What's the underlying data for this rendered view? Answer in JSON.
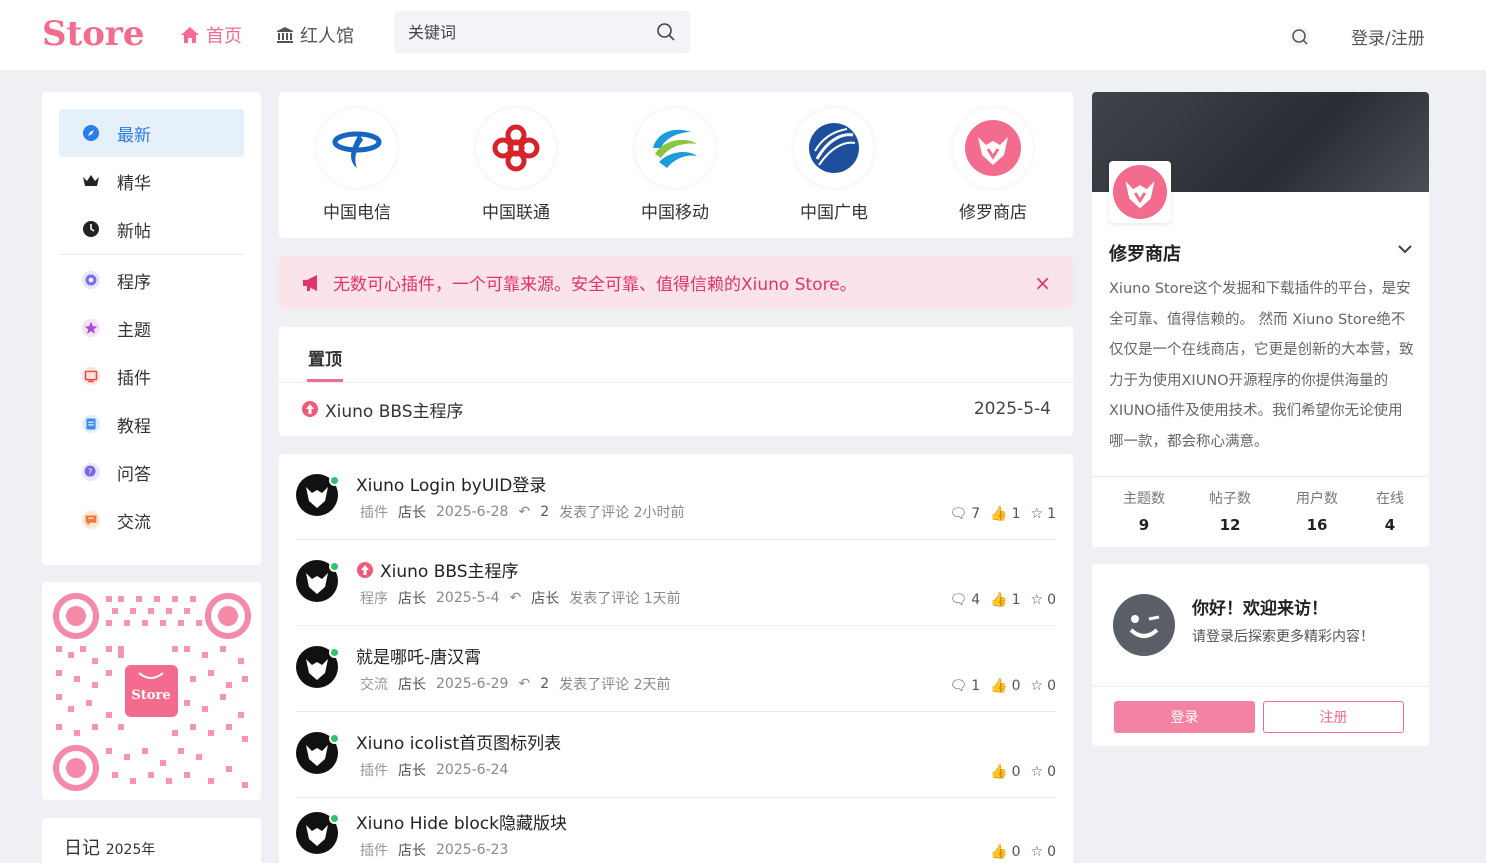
{
  "header": {
    "logo": "Store",
    "nav": [
      {
        "label": "首页",
        "icon": "home-icon"
      },
      {
        "label": "红人馆",
        "icon": "building-icon"
      }
    ],
    "search_placeholder": "关键词",
    "login_label": "登录/注册"
  },
  "left_menu": [
    {
      "label": "最新",
      "icon": "compass-icon",
      "active": true
    },
    {
      "label": "精华",
      "icon": "crown-icon"
    },
    {
      "label": "新帖",
      "icon": "clock-icon"
    },
    {
      "label": "程序",
      "icon": "gear-icon"
    },
    {
      "label": "主题",
      "icon": "star-icon"
    },
    {
      "label": "插件",
      "icon": "plugin-icon"
    },
    {
      "label": "教程",
      "icon": "document-icon"
    },
    {
      "label": "问答",
      "icon": "question-icon"
    },
    {
      "label": "交流",
      "icon": "chat-icon"
    }
  ],
  "qr": {
    "logo_text": "Store"
  },
  "diary": {
    "title": "日记",
    "year": "2025年"
  },
  "brands": [
    {
      "label": "中国电信"
    },
    {
      "label": "中国联通"
    },
    {
      "label": "中国移动"
    },
    {
      "label": "中国广电"
    },
    {
      "label": "修罗商店"
    }
  ],
  "notice": {
    "text": "无数可心插件，一个可靠来源。安全可靠、值得信赖的Xiuno Store。",
    "close": "×"
  },
  "pinned": {
    "tab": "置顶",
    "title": "Xiuno BBS主程序",
    "date": "2025-5-4"
  },
  "threads": [
    {
      "title": "Xiuno Login byUID登录",
      "top": false,
      "forum": "插件",
      "author": "店长",
      "date": "2025-6-28",
      "reply_user": "2",
      "reply_text": "发表了评论 2小时前",
      "comments": "7",
      "likes": "1",
      "favs": "1",
      "show_comments": true
    },
    {
      "title": "Xiuno BBS主程序",
      "top": true,
      "forum": "程序",
      "author": "店长",
      "date": "2025-5-4",
      "reply_user": "店长",
      "reply_text": "发表了评论 1天前",
      "comments": "4",
      "likes": "1",
      "favs": "0",
      "show_comments": true
    },
    {
      "title": "就是哪吒-唐汉霄",
      "top": false,
      "forum": "交流",
      "author": "店长",
      "date": "2025-6-29",
      "reply_user": "2",
      "reply_text": "发表了评论 2天前",
      "comments": "1",
      "likes": "0",
      "favs": "0",
      "show_comments": true
    },
    {
      "title": "Xiuno icolist首页图标列表",
      "top": false,
      "forum": "插件",
      "author": "店长",
      "date": "2025-6-24",
      "reply_user": "",
      "reply_text": "",
      "comments": "",
      "likes": "0",
      "favs": "0",
      "show_comments": false
    },
    {
      "title": "Xiuno Hide block隐藏版块",
      "top": false,
      "forum": "插件",
      "author": "店长",
      "date": "2025-6-23",
      "reply_user": "",
      "reply_text": "",
      "comments": "",
      "likes": "0",
      "favs": "0",
      "show_comments": false
    }
  ],
  "profile": {
    "name": "修罗商店",
    "description": "Xiuno Store这个发掘和下载插件的平台，是安全可靠、值得信赖的。 然而 Xiuno Store绝不仅仅是一个在线商店，它更是创新的大本营，致力于为使用XIUNO开源程序的你提供海量的XIUNO插件及使用技术。我们希望你无论使用哪一款，都会称心满意。",
    "stats": [
      {
        "label": "主题数",
        "value": "9"
      },
      {
        "label": "帖子数",
        "value": "12"
      },
      {
        "label": "用户数",
        "value": "16"
      },
      {
        "label": "在线",
        "value": "4"
      }
    ]
  },
  "welcome": {
    "hello": "你好！欢迎来访！",
    "hint": "请登录后探索更多精彩内容！",
    "login": "登录",
    "register": "注册"
  },
  "colors": {
    "accent": "#f36c8e",
    "active_blue": "#2b7de9",
    "notice_bg": "#fbe3ea"
  }
}
